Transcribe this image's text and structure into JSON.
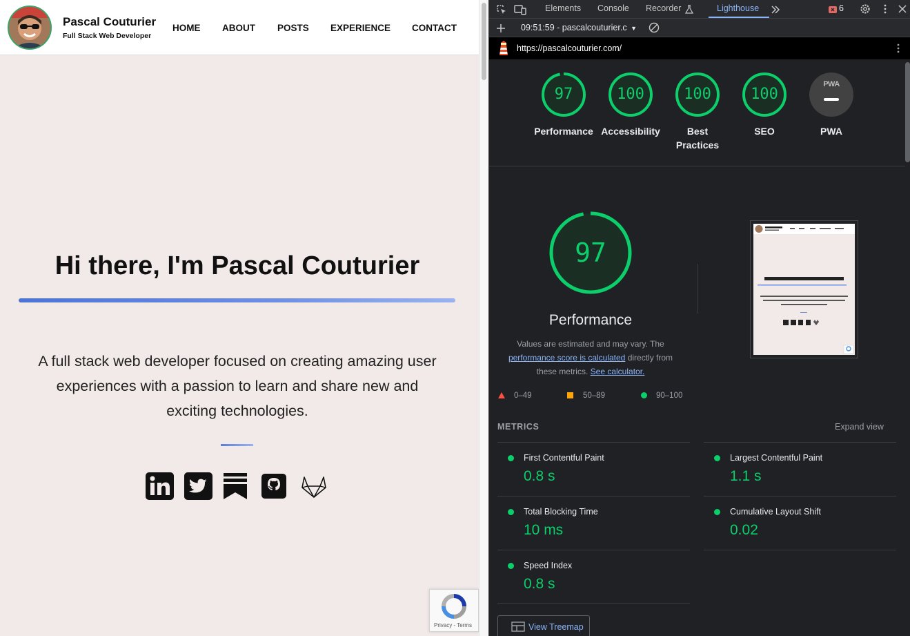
{
  "site": {
    "brand_name": "Pascal Couturier",
    "brand_tagline": "Full Stack Web Developer",
    "nav": [
      "HOME",
      "ABOUT",
      "POSTS",
      "EXPERIENCE",
      "CONTACT"
    ],
    "hero_title": "Hi there, I'm Pascal Couturier",
    "hero_description_lines": [
      "A full stack web developer focused on creating amazing user",
      "experiences with a passion to learn and share new and",
      "exciting technologies."
    ],
    "social_icons": [
      "linkedin-icon",
      "twitter-icon",
      "substack-icon",
      "github-icon",
      "gitlab-icon"
    ],
    "recaptcha_footer": "Privacy - Terms"
  },
  "devtools": {
    "tabs": [
      "Elements",
      "Console",
      "Recorder",
      "Lighthouse"
    ],
    "active_tab": "Lighthouse",
    "error_count": "6",
    "report_time_url": "09:51:59 - pascalcouturier.c",
    "url": "https://pascalcouturier.com/",
    "gauges": [
      {
        "score": "97",
        "label": "Performance"
      },
      {
        "score": "100",
        "label": "Accessibility"
      },
      {
        "score": "100",
        "label": "Best Practices"
      },
      {
        "score": "100",
        "label": "SEO"
      },
      {
        "score": "",
        "label": "PWA"
      }
    ],
    "pwa_badge": "PWA",
    "performance": {
      "score": "97",
      "title": "Performance",
      "desc_prefix": "Values are estimated and may vary. The",
      "desc_link": "performance score is calculated",
      "desc_mid": "directly from",
      "desc_tail": "these metrics.",
      "calculator_link": "See calculator."
    },
    "legend": [
      "0–49",
      "50–89",
      "90–100"
    ],
    "metrics_title": "METRICS",
    "expand_view": "Expand view",
    "metrics": [
      {
        "name": "First Contentful Paint",
        "value": "0.8 s"
      },
      {
        "name": "Largest Contentful Paint",
        "value": "1.1 s"
      },
      {
        "name": "Total Blocking Time",
        "value": "10 ms"
      },
      {
        "name": "Cumulative Layout Shift",
        "value": "0.02"
      },
      {
        "name": "Speed Index",
        "value": "0.8 s"
      }
    ],
    "view_treemap": "View Treemap",
    "colors": {
      "pass": "#0cce6b",
      "average": "#ffa400",
      "fail": "#ff4e42",
      "link": "#8ab4f8"
    }
  }
}
